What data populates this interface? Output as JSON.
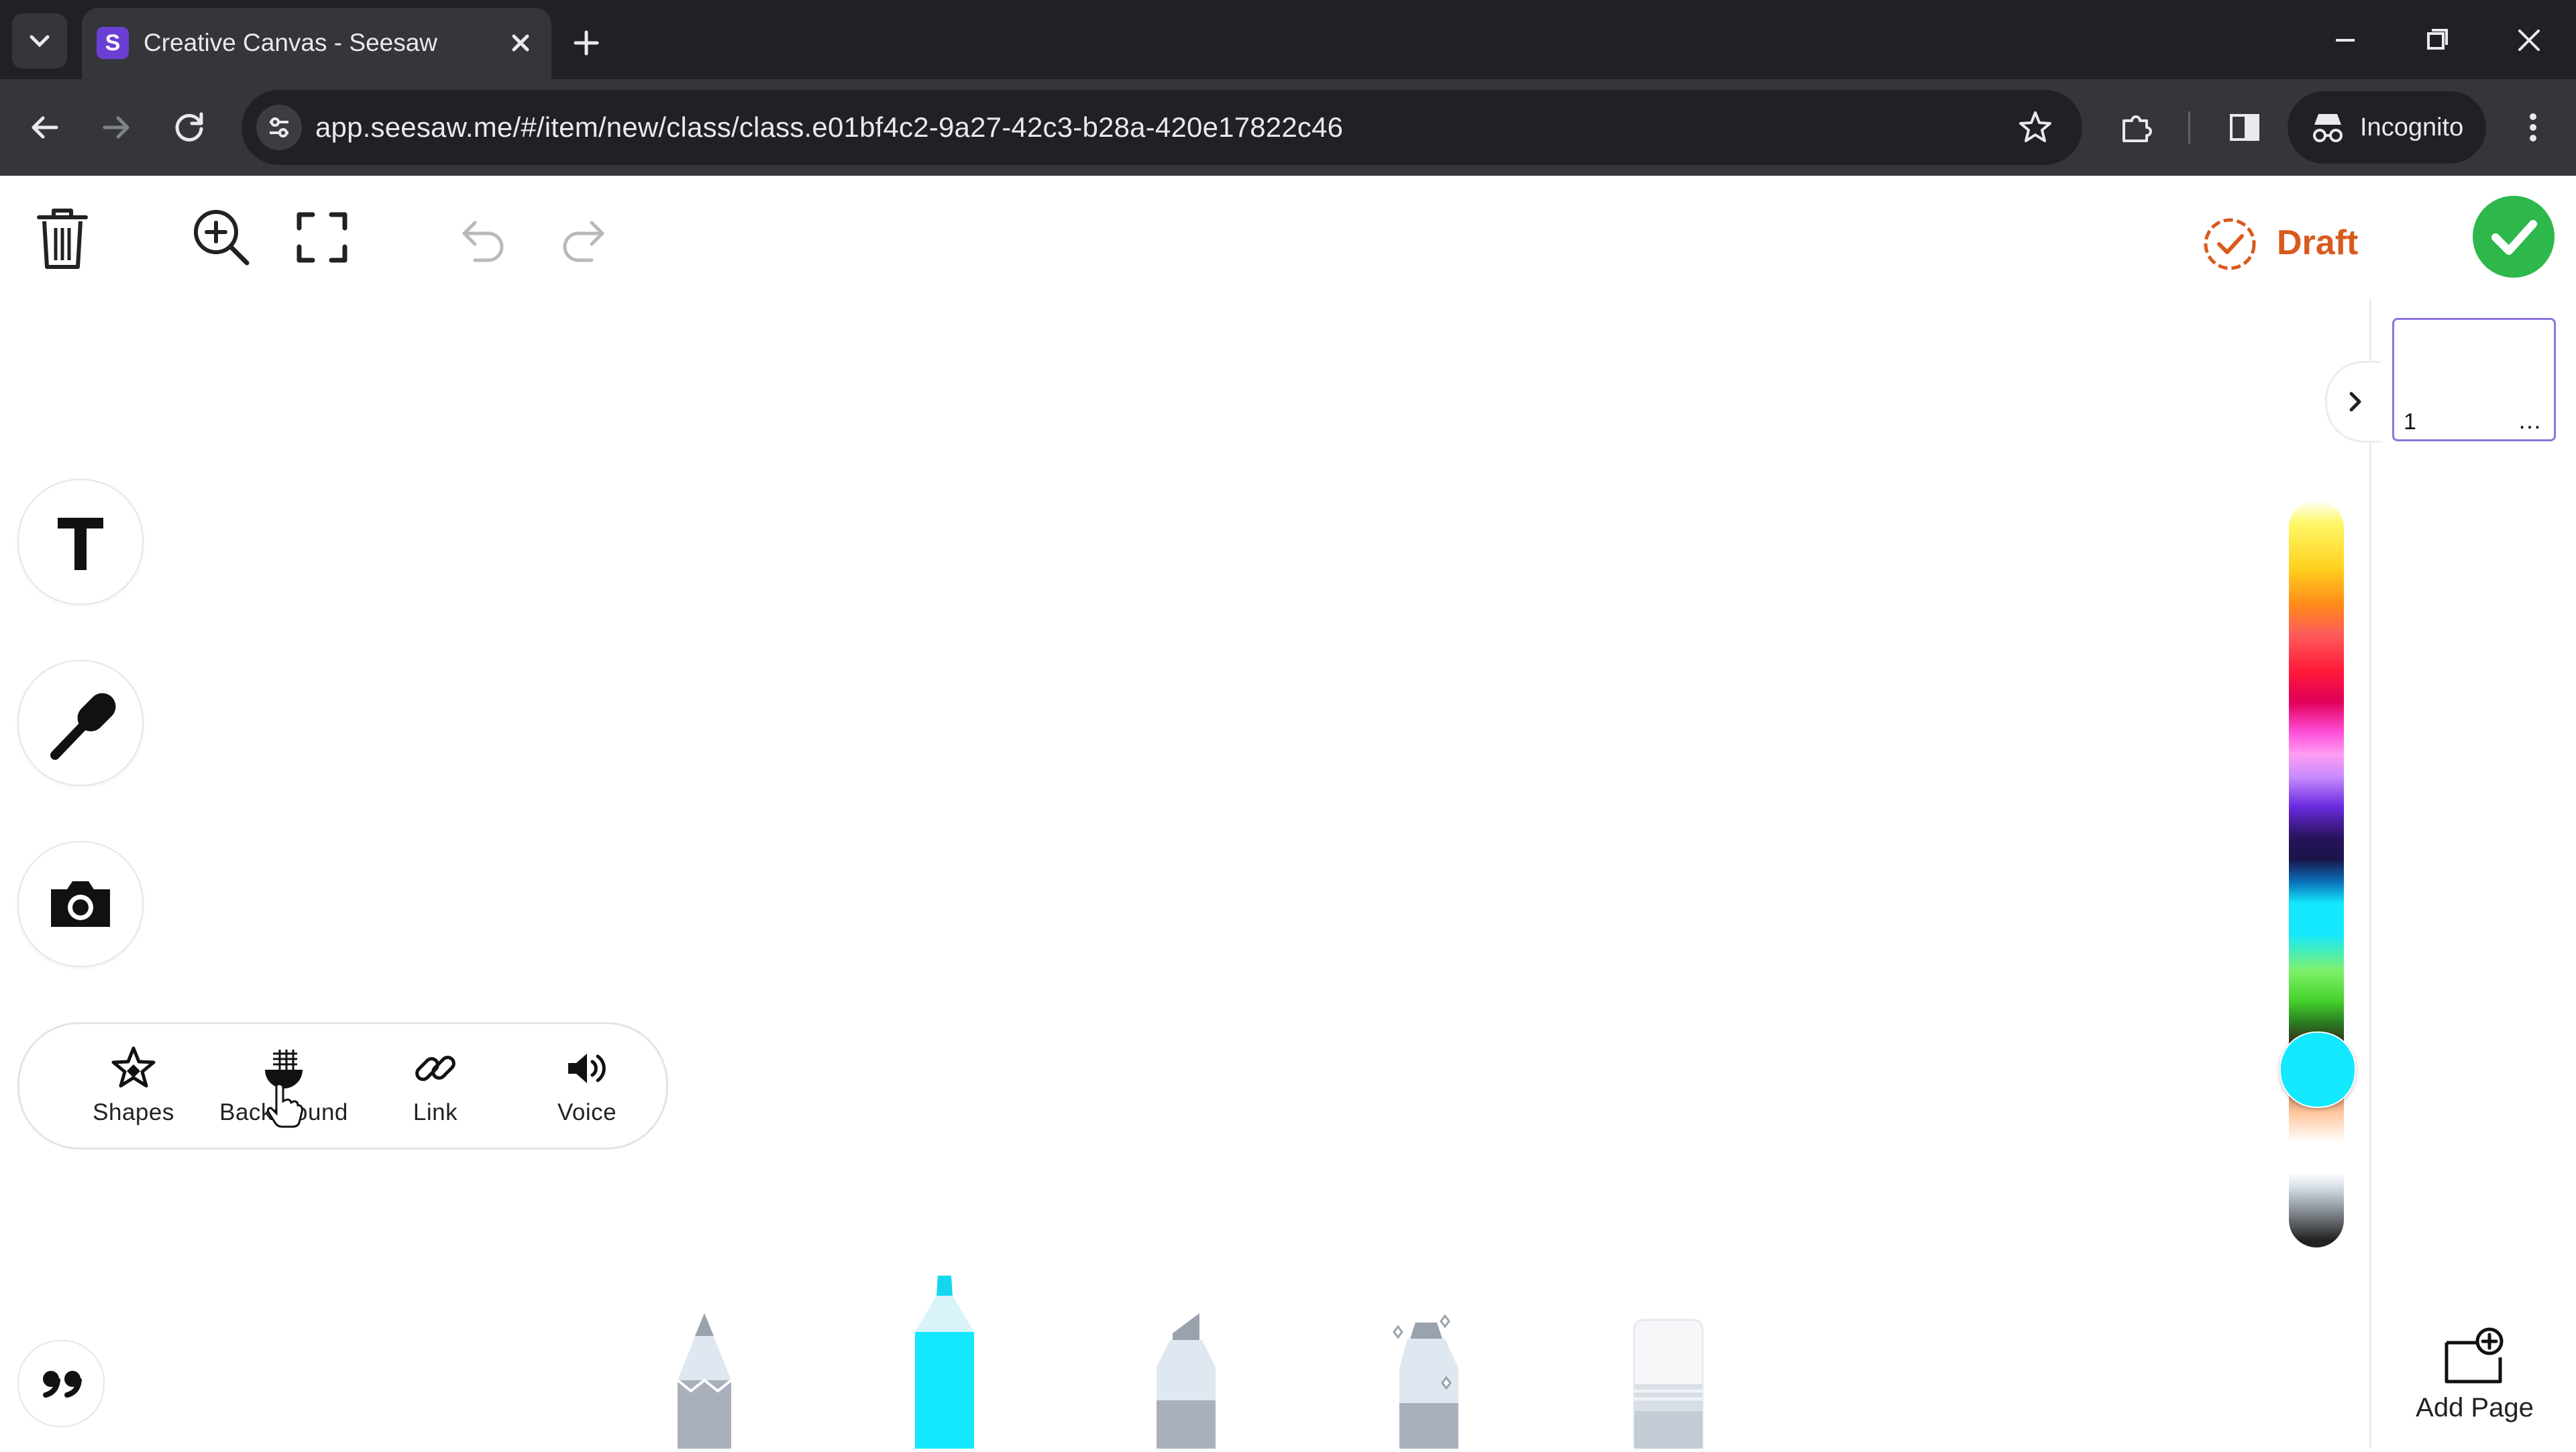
{
  "browser": {
    "tab_title": "Creative Canvas - Seesaw",
    "favicon_letter": "S",
    "url": "app.seesaw.me/#/item/new/class/class.e01bf4c2-9a27-42c3-b28a-420e17822c46",
    "profile_label": "Incognito"
  },
  "header": {
    "draft_label": "Draft"
  },
  "tools": {
    "more": [
      {
        "label": "Shapes",
        "icon": "star-shapes-icon"
      },
      {
        "label": "Background",
        "icon": "background-icon"
      },
      {
        "label": "Link",
        "icon": "link-icon"
      },
      {
        "label": "Voice",
        "icon": "speaker-icon"
      }
    ]
  },
  "pages": {
    "current_page_number": "1",
    "add_page_label": "Add Page"
  },
  "colors": {
    "selected_color": "#13e8ff",
    "draft_accent": "#d95a1e",
    "done_green": "#2eb84b",
    "page_highlight": "#8d74d9"
  },
  "drawing_tools": [
    "pencil-icon",
    "marker-icon",
    "highlighter-icon",
    "glitter-pen-icon",
    "eraser-icon"
  ]
}
